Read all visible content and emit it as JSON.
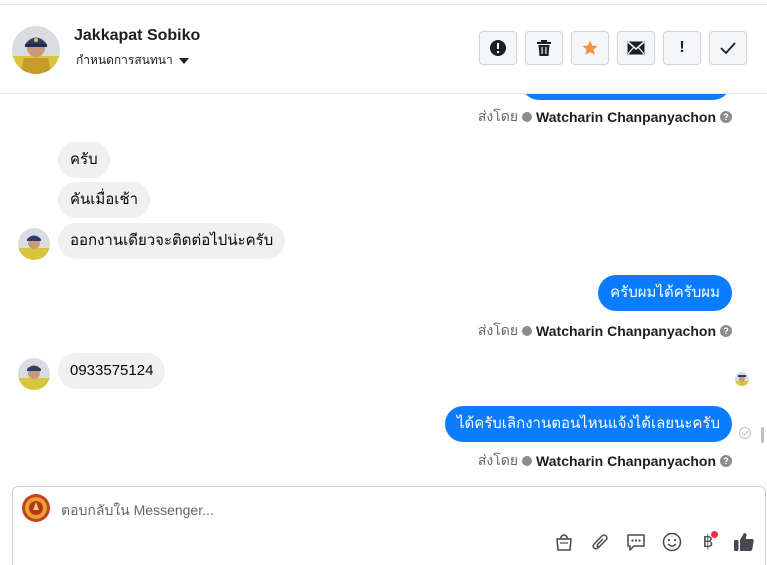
{
  "header": {
    "contact_name": "Jakkapat Sobiko",
    "assign_label": "กำหนดการสนทนา",
    "actions": [
      {
        "icon": "alert-circle-icon",
        "name": "mark-spam-button"
      },
      {
        "icon": "trash-icon",
        "name": "delete-button"
      },
      {
        "icon": "star-icon",
        "name": "star-button"
      },
      {
        "icon": "envelope-icon",
        "name": "mark-unread-button"
      },
      {
        "icon": "exclamation-icon",
        "name": "follow-up-button",
        "glyph": "!"
      },
      {
        "icon": "check-icon",
        "name": "mark-done-button"
      }
    ]
  },
  "thread": {
    "sent_by_prefix": "ส่งโดย",
    "agent_name": "Watcharin Chanpanyachon",
    "messages": [
      {
        "direction": "incoming",
        "text": "ครับ"
      },
      {
        "direction": "incoming",
        "text": "คันเมื่อเช้า"
      },
      {
        "direction": "incoming",
        "text": "ออกงานเดียวจะติดต่อไปน่ะครับ"
      },
      {
        "direction": "outgoing",
        "text": "ครับผมได้ครับผม"
      },
      {
        "direction": "incoming",
        "text": "0933575124"
      },
      {
        "direction": "outgoing",
        "text": "ได้ครับเลิกงานตอนไหนแจ้งได้เลยนะครับ"
      }
    ]
  },
  "composer": {
    "placeholder": "ตอบกลับใน Messenger...",
    "baht_symbol": "฿",
    "tools": [
      "shopping-bag-icon",
      "paperclip-icon",
      "saved-reply-icon",
      "emoji-icon",
      "baht-icon",
      "thumbs-up-icon"
    ]
  },
  "colors": {
    "outgoing_bubble": "#0a7cff",
    "incoming_bubble": "#f0f0f0",
    "star": "#f7923a",
    "badge": "#f02849"
  }
}
